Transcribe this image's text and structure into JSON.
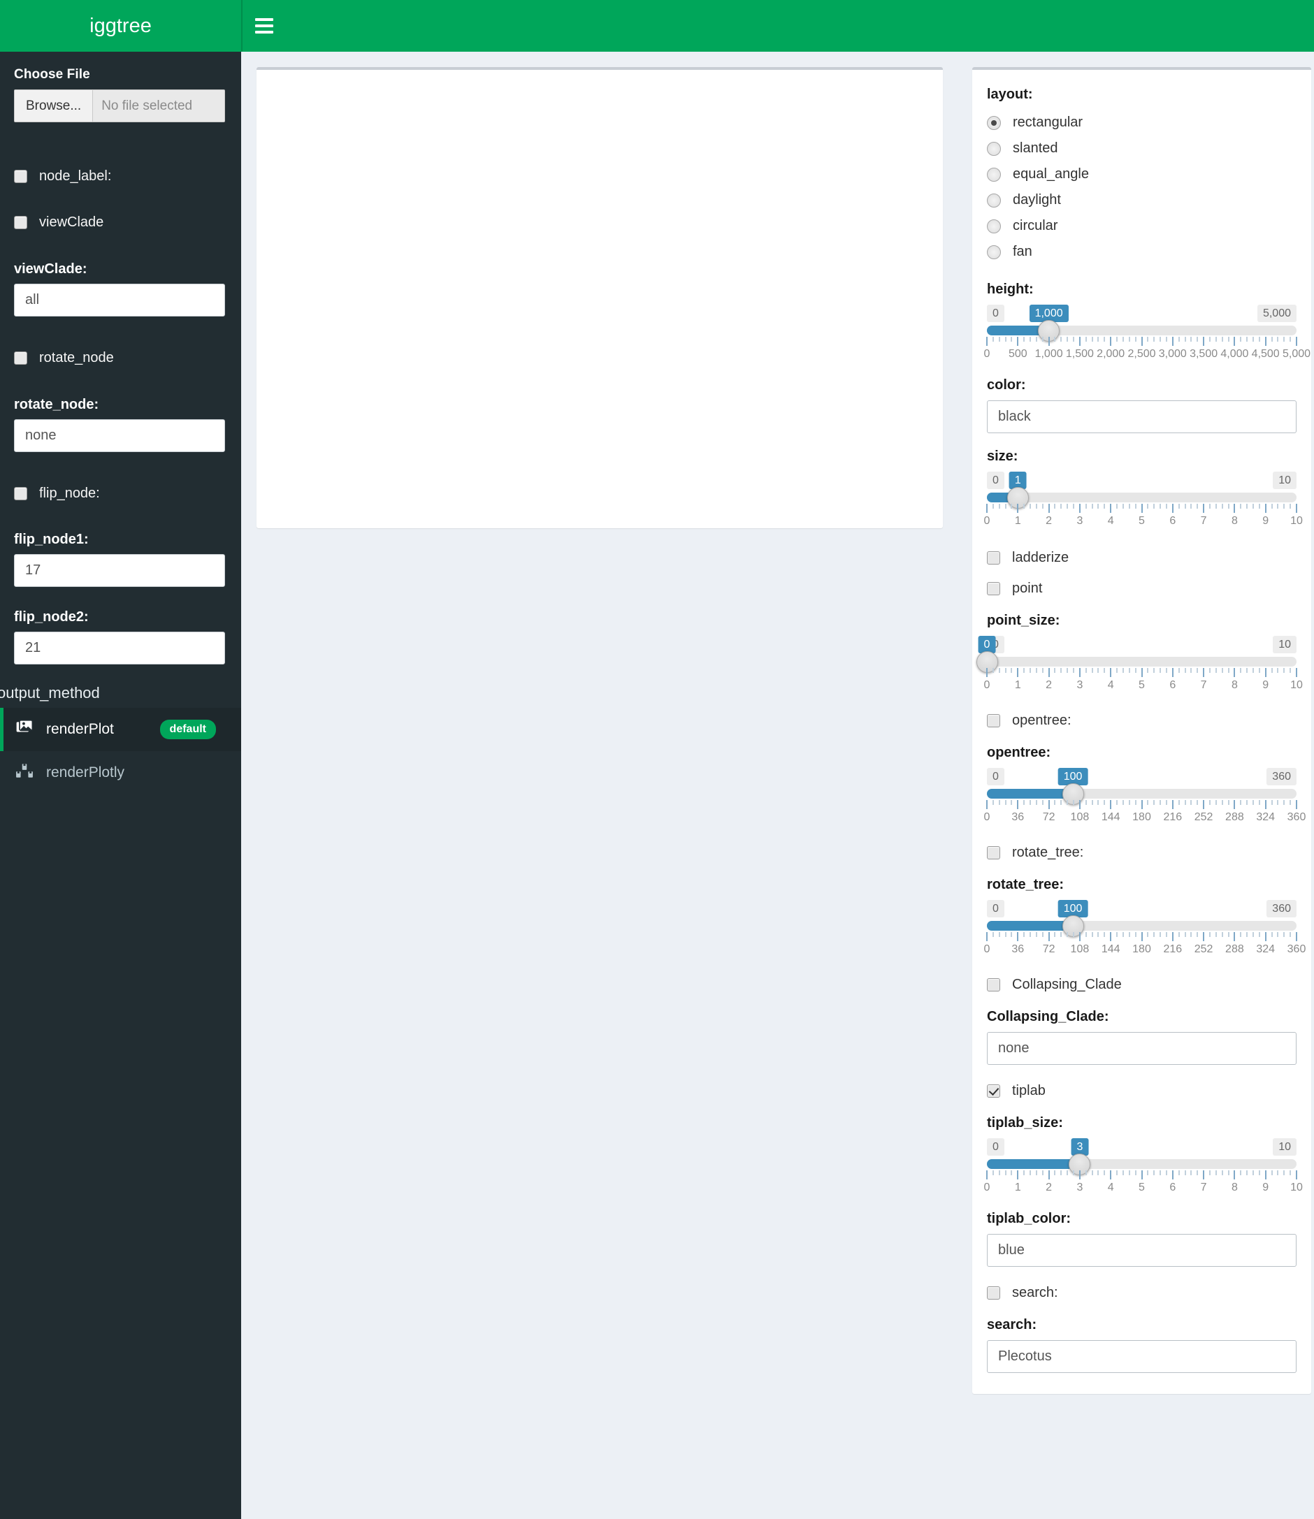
{
  "header": {
    "brand": "iggtree",
    "menu_icon": "hamburger-icon"
  },
  "sidebar": {
    "choose_file_label": "Choose File",
    "file_browse_label": "Browse...",
    "file_name_placeholder": "No file selected",
    "checks": [
      {
        "label": "node_label:",
        "checked": false
      },
      {
        "label": "viewClade",
        "checked": false
      },
      {
        "label": "rotate_node",
        "checked": false
      },
      {
        "label": "flip_node:",
        "checked": false
      }
    ],
    "fields": [
      {
        "label": "viewClade:",
        "value": "all"
      },
      {
        "label": "rotate_node:",
        "value": "none"
      },
      {
        "label": "flip_node1:",
        "value": "17"
      },
      {
        "label": "flip_node2:",
        "value": "21"
      }
    ],
    "output_method_title": "output_method",
    "output_methods": [
      {
        "label": "renderPlot",
        "icon": "images-icon",
        "badge": "default",
        "active": true
      },
      {
        "label": "renderPlotly",
        "icon": "bar-chart-icon",
        "badge": "",
        "active": false
      }
    ]
  },
  "options": {
    "layout": {
      "title": "layout:",
      "selected": "rectangular",
      "choices": [
        "rectangular",
        "slanted",
        "equal_angle",
        "daylight",
        "circular",
        "fan"
      ]
    },
    "height": {
      "title": "height:",
      "value": "1,000",
      "min": "0",
      "max": "5,000",
      "min_num": 0,
      "max_num": 5000,
      "value_num": 1000,
      "ticks": [
        "0",
        "500",
        "1,000",
        "1,500",
        "2,000",
        "2,500",
        "3,000",
        "3,500",
        "4,000",
        "4,500",
        "5,000"
      ]
    },
    "color": {
      "title": "color:",
      "value": "black"
    },
    "size": {
      "title": "size:",
      "value": "1",
      "min": "0",
      "max": "10",
      "min_num": 0,
      "max_num": 10,
      "value_num": 1,
      "ticks": [
        "0",
        "1",
        "2",
        "3",
        "4",
        "5",
        "6",
        "7",
        "8",
        "9",
        "10"
      ]
    },
    "ladderize": {
      "label": "ladderize",
      "checked": false
    },
    "point": {
      "label": "point",
      "checked": false
    },
    "point_size": {
      "title": "point_size:",
      "value": "0",
      "min": "0",
      "max": "10",
      "min_num": 0,
      "max_num": 10,
      "value_num": 0,
      "ticks": [
        "0",
        "1",
        "2",
        "3",
        "4",
        "5",
        "6",
        "7",
        "8",
        "9",
        "10"
      ]
    },
    "opentree_check": {
      "label": "opentree:",
      "checked": false
    },
    "opentree": {
      "title": "opentree:",
      "value": "100",
      "min": "0",
      "max": "360",
      "min_num": 0,
      "max_num": 360,
      "value_num": 100,
      "ticks": [
        "0",
        "36",
        "72",
        "108",
        "144",
        "180",
        "216",
        "252",
        "288",
        "324",
        "360"
      ]
    },
    "rotate_tree_check": {
      "label": "rotate_tree:",
      "checked": false
    },
    "rotate_tree": {
      "title": "rotate_tree:",
      "value": "100",
      "min": "0",
      "max": "360",
      "min_num": 0,
      "max_num": 360,
      "value_num": 100,
      "ticks": [
        "0",
        "36",
        "72",
        "108",
        "144",
        "180",
        "216",
        "252",
        "288",
        "324",
        "360"
      ]
    },
    "collapsing_check": {
      "label": "Collapsing_Clade",
      "checked": false
    },
    "collapsing_field": {
      "title": "Collapsing_Clade:",
      "value": "none"
    },
    "tiplab_check": {
      "label": "tiplab",
      "checked": true
    },
    "tiplab_size": {
      "title": "tiplab_size:",
      "value": "3",
      "min": "0",
      "max": "10",
      "min_num": 0,
      "max_num": 10,
      "value_num": 3,
      "ticks": [
        "0",
        "1",
        "2",
        "3",
        "4",
        "5",
        "6",
        "7",
        "8",
        "9",
        "10"
      ]
    },
    "tiplab_color": {
      "title": "tiplab_color:",
      "value": "blue"
    },
    "search_check": {
      "label": "search:",
      "checked": false
    },
    "search_field": {
      "title": "search:",
      "value": "Plecotus"
    }
  },
  "colors": {
    "brand_green": "#00a65a",
    "sidebar_dark": "#222d32",
    "slider_blue": "#3c8dbc",
    "page_bg": "#ecf0f5"
  }
}
